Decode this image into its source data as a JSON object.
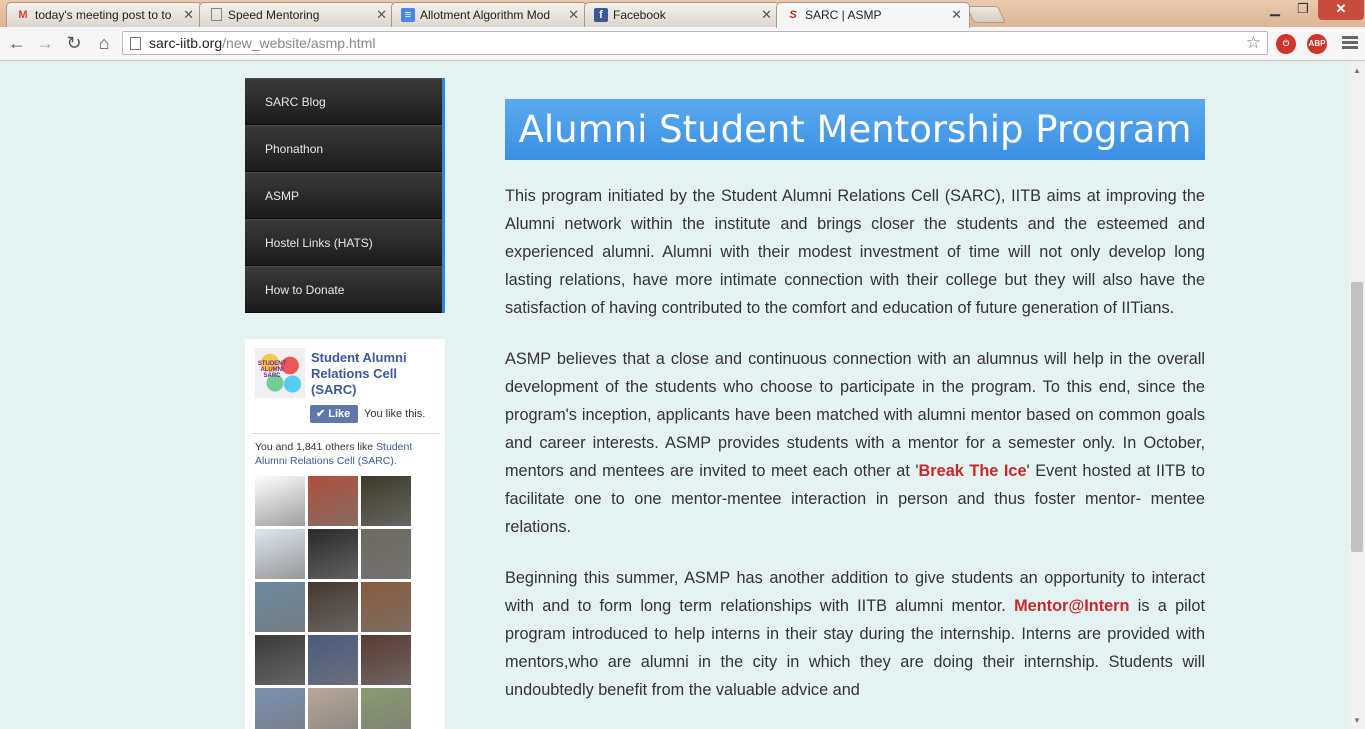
{
  "browser": {
    "tabs": [
      {
        "title": "today's meeting post to to",
        "icon": "gmail-icon",
        "glyph": "M",
        "color": "#d44638"
      },
      {
        "title": "Speed Mentoring",
        "icon": "page-icon",
        "glyph": "",
        "color": "#777777"
      },
      {
        "title": "Allotment Algorithm Mod",
        "icon": "docs-icon",
        "glyph": "≡",
        "color": "#4a86e8"
      },
      {
        "title": "Facebook",
        "icon": "facebook-icon",
        "glyph": "f",
        "color": "#3b5998"
      },
      {
        "title": "SARC | ASMP",
        "icon": "sarc-icon",
        "glyph": "S",
        "color": "#c8282a"
      }
    ],
    "active_tab": 4,
    "url_host": "sarc-iitb.org",
    "url_path": "/new_website/asmp.html",
    "window_controls": {
      "minimize": "▁",
      "restore": "❐",
      "close": "✕"
    }
  },
  "sidebar": {
    "items": [
      "SARC Blog",
      "Phonathon",
      "ASMP",
      "Hostel Links (HATS)",
      "How to Donate"
    ]
  },
  "fb_widget": {
    "page_name": "Student Alumni Relations Cell (SARC)",
    "logo_text": "STUDENT ALUMNI SARC",
    "like_label": "Like",
    "you_like": "You like this.",
    "others_prefix": "You and 1,841 others like ",
    "others_link": "Student Alumni Relations Cell (SARC).",
    "faces": [
      "#ffffff",
      "#b0503a",
      "#3d3a28",
      "#dfe7ef",
      "#2a2a2a",
      "#6d6a60",
      "#6c8aa0",
      "#453830",
      "#8a5a3a",
      "#3a3a3a",
      "#4a5a80",
      "#5a3a32",
      "#7a90b0",
      "#b8a898",
      "#8a9a70"
    ]
  },
  "main": {
    "title": "Alumni Student Mentorship Program",
    "para1": "This program initiated by the Student Alumni Relations Cell (SARC), IITB aims at improving the Alumni network within the institute and brings closer the students and the esteemed and experienced alumni. Alumni with their modest investment of time will not only develop long lasting relations, have more intimate connection with their college but they will also have the satisfaction of having contributed to the comfort and education of future generation of IITians.",
    "para2_a": "ASMP believes that a close and continuous connection with an alumnus will help in the overall development of the students who choose to participate in the program. To this end, since the program's inception, applicants have been matched with alumni mentor based on common goals and career interests. ASMP provides students with a mentor for a semester only. In October, mentors and mentees are invited to meet each other at '",
    "para2_link": "Break The Ice",
    "para2_b": "' Event hosted at IITB to facilitate one to one mentor-mentee interaction in person and thus foster mentor- mentee relations.",
    "para3_a": "Beginning this summer, ASMP has another addition to give students an opportunity to interact with and to form long term relationships with IITB alumni mentor. ",
    "para3_link": "Mentor@Intern",
    "para3_b": " is a pilot program introduced to help interns in their stay during the internship. Interns are provided with mentors,who are alumni in the city in which they are doing their internship. Students will undoubtedly benefit from the valuable advice and"
  }
}
